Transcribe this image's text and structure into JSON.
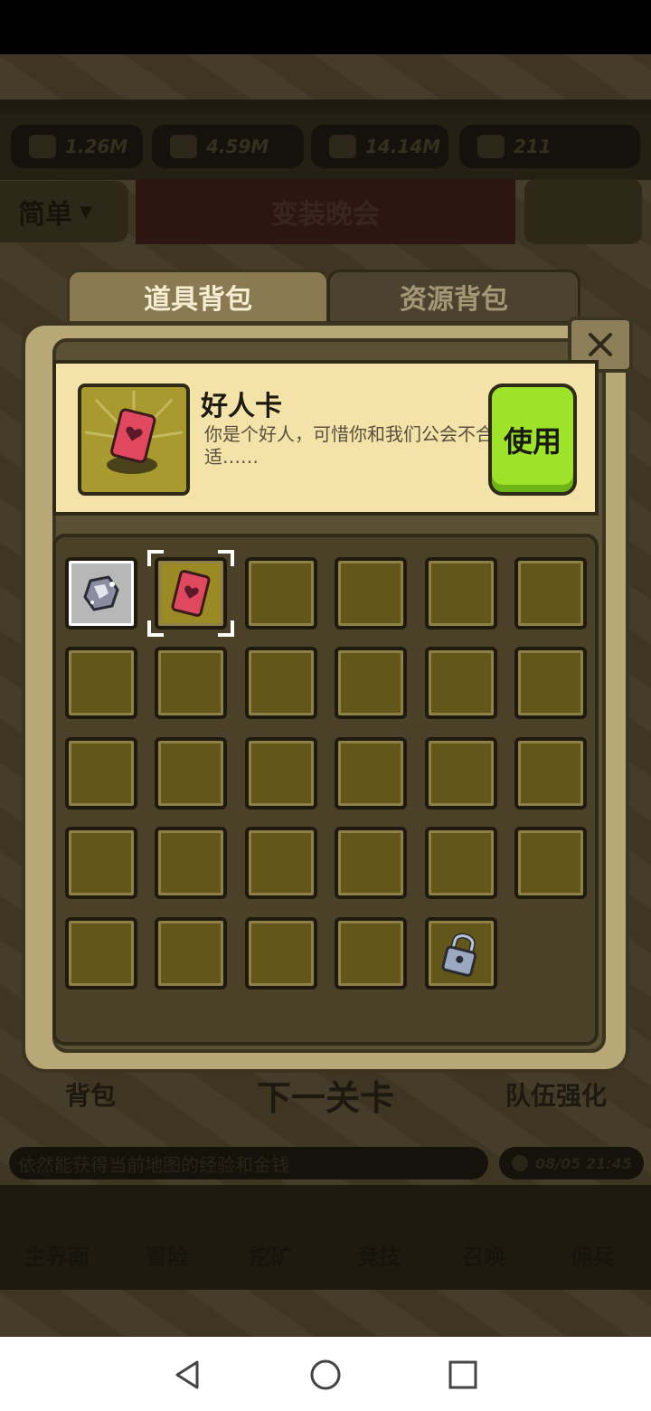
{
  "background": {
    "resources": [
      {
        "icon": "sword-icon",
        "value": "1.26M"
      },
      {
        "icon": "exp-icon",
        "value": "4.59M"
      },
      {
        "icon": "coin-icon",
        "value": "14.14M"
      },
      {
        "icon": "gem-icon",
        "value": "211"
      }
    ],
    "difficulty_label": "简单",
    "stage_title": "变装晚会",
    "bottom_buttons": {
      "bag": "背包",
      "next_stage": "下一关卡",
      "team_upgrade": "队伍强化"
    },
    "tip_text": "依然能获得当前地图的经验和金钱",
    "datetime": "08/05 21:45",
    "nav_items": [
      "主界面",
      "冒险",
      "挖矿",
      "竞技",
      "召唤",
      "佣兵"
    ]
  },
  "bag": {
    "tabs": [
      {
        "label": "道具背包",
        "active": true
      },
      {
        "label": "资源背包",
        "active": false
      }
    ],
    "close_icon": "close-icon",
    "selected_item": {
      "name": "好人卡",
      "description": "你是个好人，可惜你和我们公会不合适……",
      "use_label": "使用",
      "icon": "heart-card-icon"
    },
    "slots": [
      {
        "item": "silver-ore-icon",
        "selected": false
      },
      {
        "item": "heart-card-icon",
        "selected": true
      },
      {
        "item": null
      },
      {
        "item": null
      },
      {
        "item": null
      },
      {
        "item": null
      },
      {
        "item": null
      },
      {
        "item": null
      },
      {
        "item": null
      },
      {
        "item": null
      },
      {
        "item": null
      },
      {
        "item": null
      },
      {
        "item": null
      },
      {
        "item": null
      },
      {
        "item": null
      },
      {
        "item": null
      },
      {
        "item": null
      },
      {
        "item": null
      },
      {
        "item": null
      },
      {
        "item": null
      },
      {
        "item": null
      },
      {
        "item": null
      },
      {
        "item": null
      },
      {
        "item": null
      },
      {
        "item": null
      },
      {
        "item": null
      },
      {
        "item": null
      },
      {
        "item": null
      },
      {
        "item": "padlock-icon",
        "locked": true
      }
    ]
  },
  "system_nav": {
    "back": "back-icon",
    "home": "home-icon",
    "recents": "recents-icon"
  },
  "colors": {
    "use_button": "#9de32a",
    "panel": "#b9a877",
    "slot": "#625618",
    "detail_bg": "#f3e3a8"
  }
}
